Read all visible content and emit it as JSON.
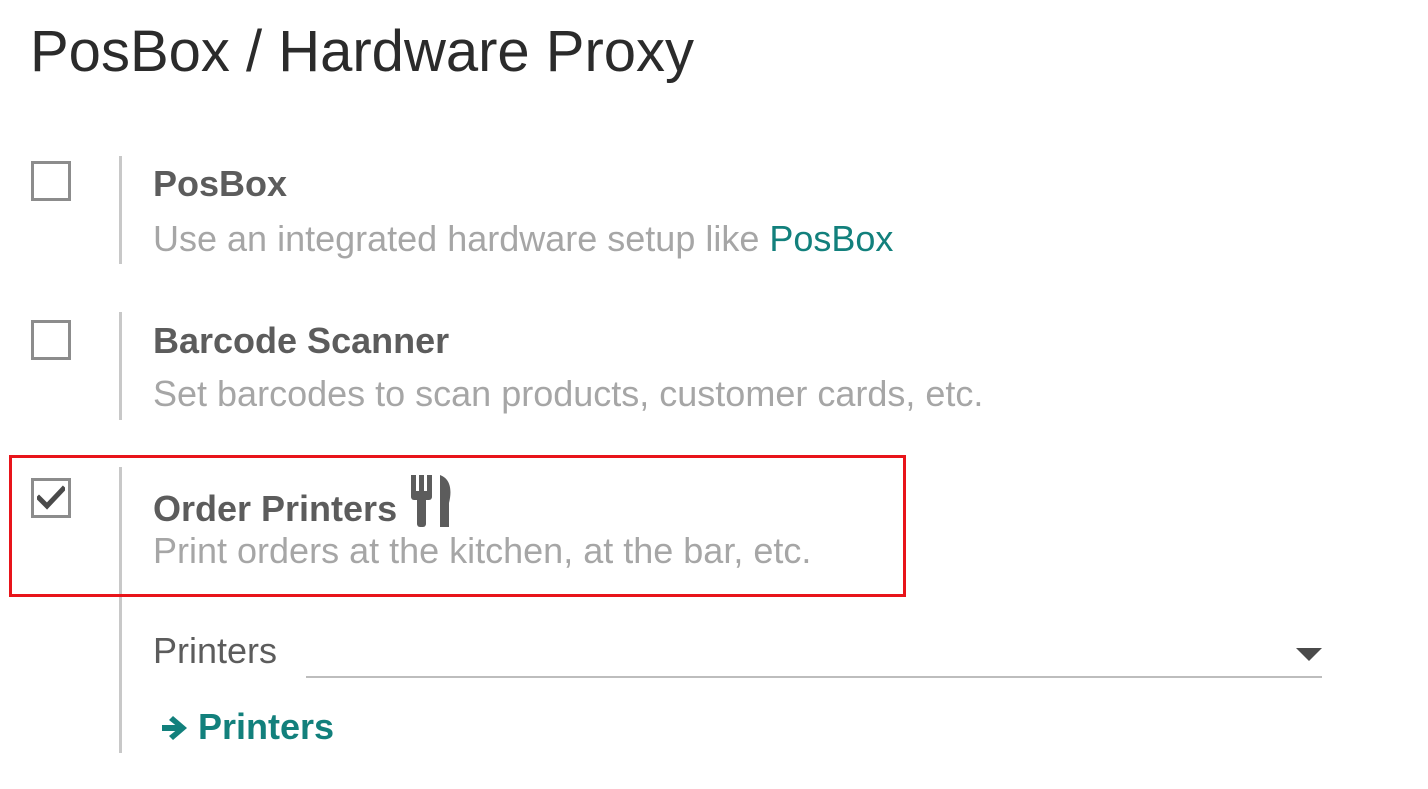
{
  "page": {
    "title": "PosBox / Hardware Proxy"
  },
  "settings": [
    {
      "title": "PosBox",
      "checked": false,
      "description_prefix": "Use an integrated hardware setup like ",
      "description_link": "PosBox"
    },
    {
      "title": "Barcode Scanner",
      "checked": false,
      "description": "Set barcodes to scan products, customer cards, etc."
    },
    {
      "title": "Order Printers",
      "checked": true,
      "icon": "fork-knife-icon",
      "description": "Print orders at the kitchen, at the bar, etc."
    }
  ],
  "printers_field": {
    "label": "Printers",
    "value": ""
  },
  "printers_link": {
    "label": "Printers",
    "icon": "arrow-right-icon"
  },
  "colors": {
    "accent": "#12807c",
    "highlight": "#e8141a"
  }
}
